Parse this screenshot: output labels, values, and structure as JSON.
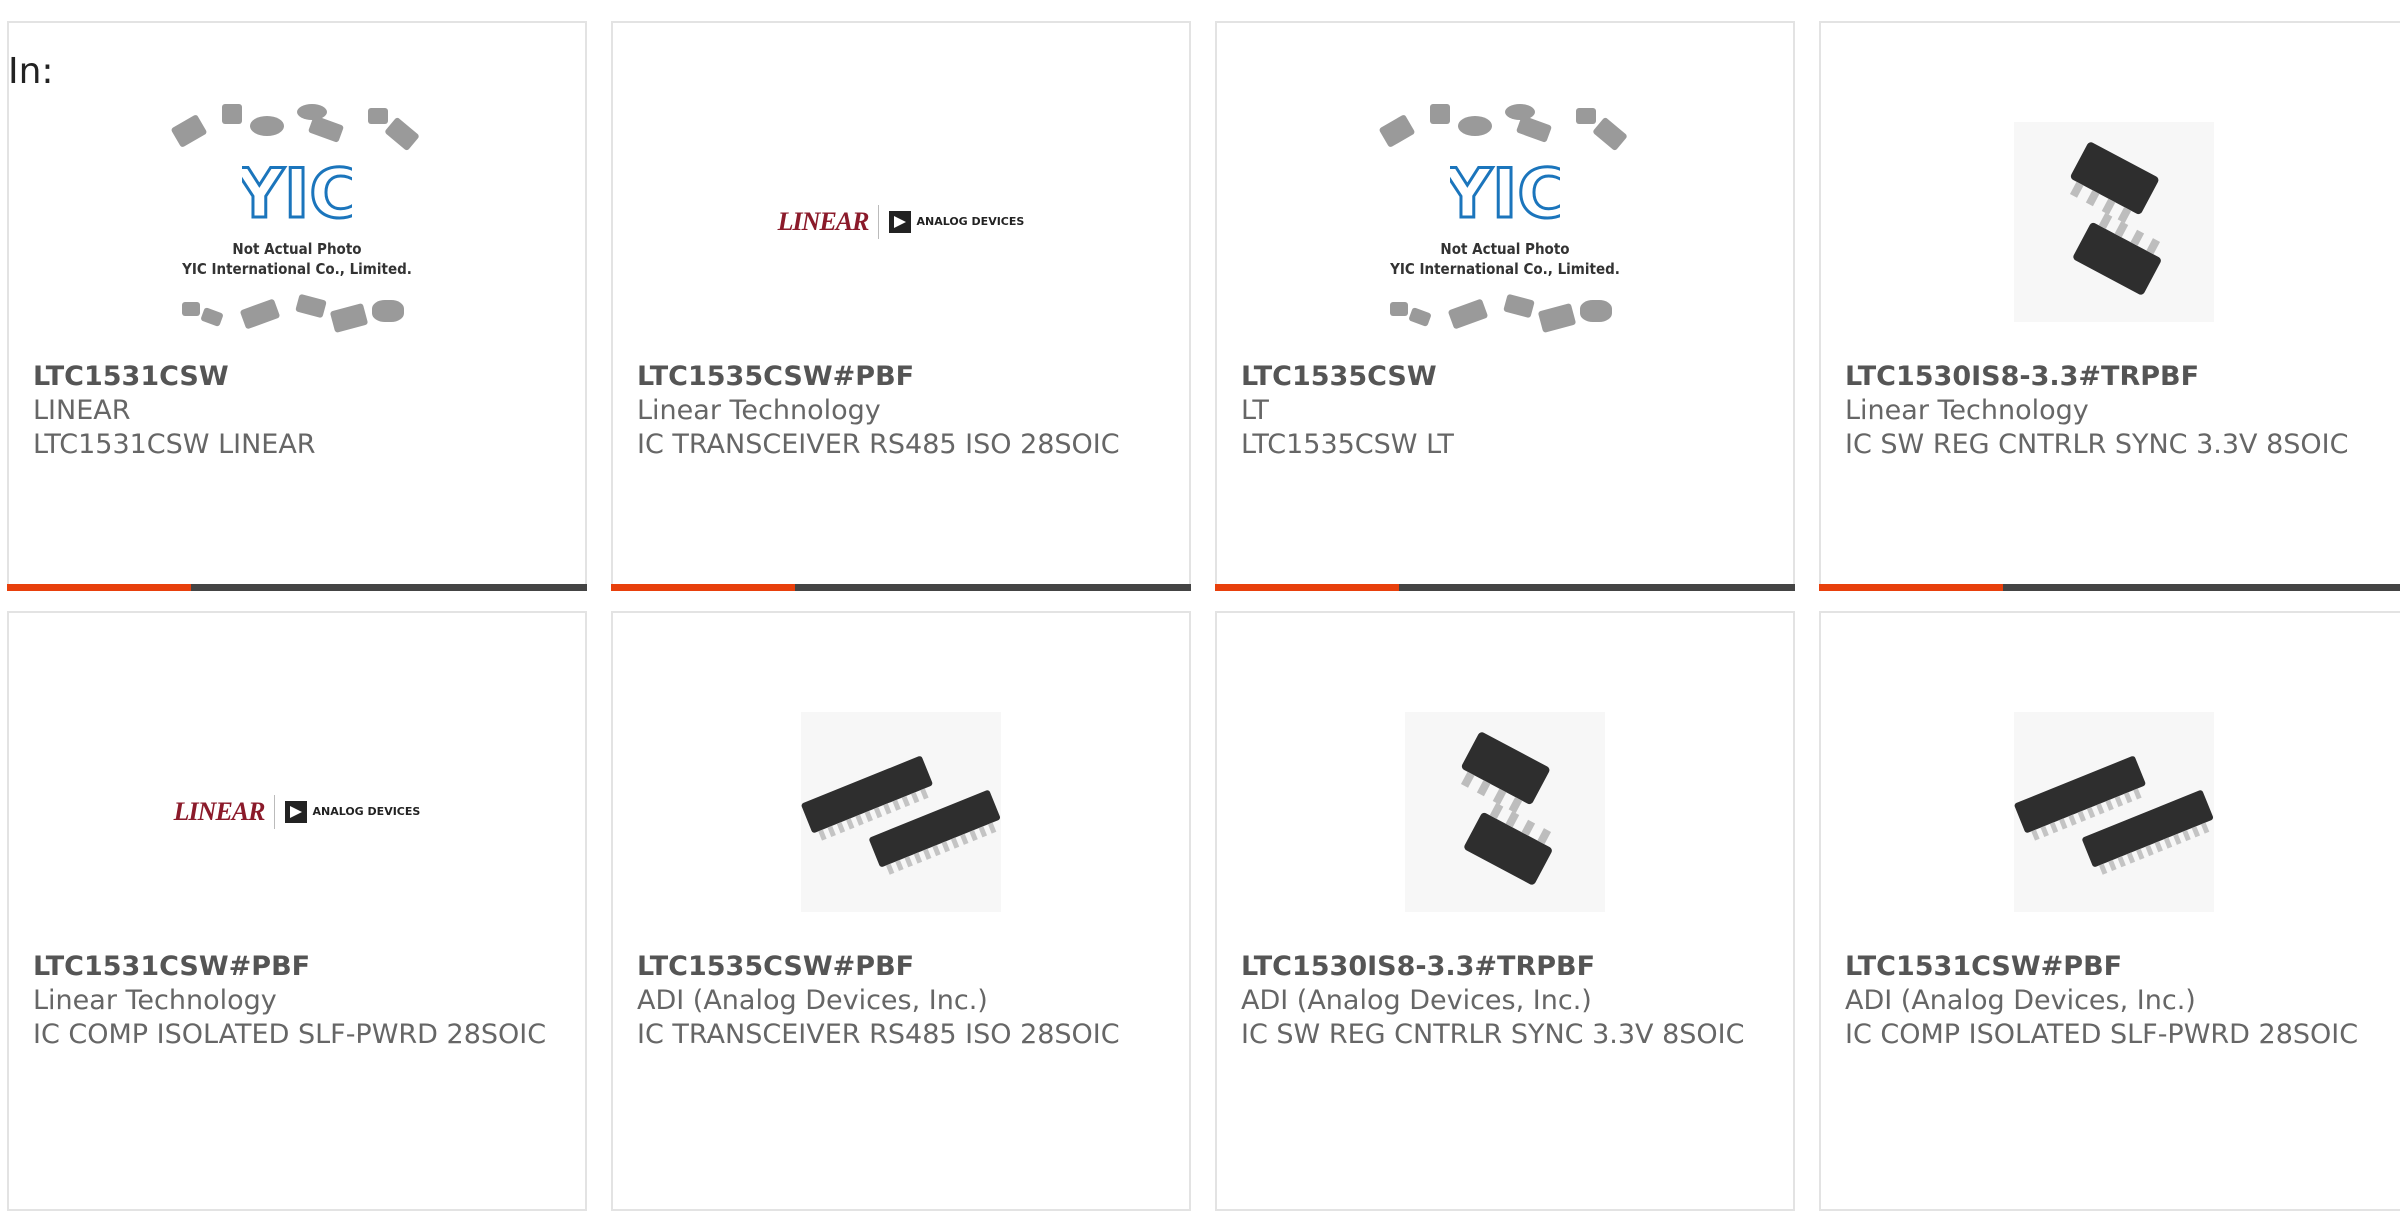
{
  "filter_label": "In:",
  "colors": {
    "accent": "#e8400c",
    "bar": "#444444",
    "border": "#e3e3e3"
  },
  "placeholder": {
    "line1": "Not Actual Photo",
    "line2": "YIC International Co., Limited."
  },
  "logo": {
    "lt": "LINEAR",
    "adi": "ANALOG DEVICES"
  },
  "products": [
    {
      "part": "LTC1531CSW",
      "mfr": "LINEAR",
      "desc": "LTC1531CSW LINEAR",
      "image": "placeholder"
    },
    {
      "part": "LTC1535CSW#PBF",
      "mfr": "Linear Technology",
      "desc": "IC TRANSCEIVER RS485 ISO 28SOIC",
      "image": "logo"
    },
    {
      "part": "LTC1535CSW",
      "mfr": "LT",
      "desc": "LTC1535CSW LT",
      "image": "placeholder"
    },
    {
      "part": "LTC1530IS8-3.3#TRPBF",
      "mfr": "Linear Technology",
      "desc": "IC SW REG CNTRLR SYNC 3.3V 8SOIC",
      "image": "soic8"
    },
    {
      "part": "LTC1531CSW#PBF",
      "mfr": "Linear Technology",
      "desc": "IC COMP ISOLATED SLF-PWRD 28SOIC",
      "image": "logo"
    },
    {
      "part": "LTC1535CSW#PBF",
      "mfr": "ADI (Analog Devices, Inc.)",
      "desc": "IC TRANSCEIVER RS485 ISO 28SOIC",
      "image": "soic28"
    },
    {
      "part": "LTC1530IS8-3.3#TRPBF",
      "mfr": "ADI (Analog Devices, Inc.)",
      "desc": "IC SW REG CNTRLR SYNC 3.3V 8SOIC",
      "image": "soic8"
    },
    {
      "part": "LTC1531CSW#PBF",
      "mfr": "ADI (Analog Devices, Inc.)",
      "desc": "IC COMP ISOLATED SLF-PWRD 28SOIC",
      "image": "soic28"
    }
  ]
}
